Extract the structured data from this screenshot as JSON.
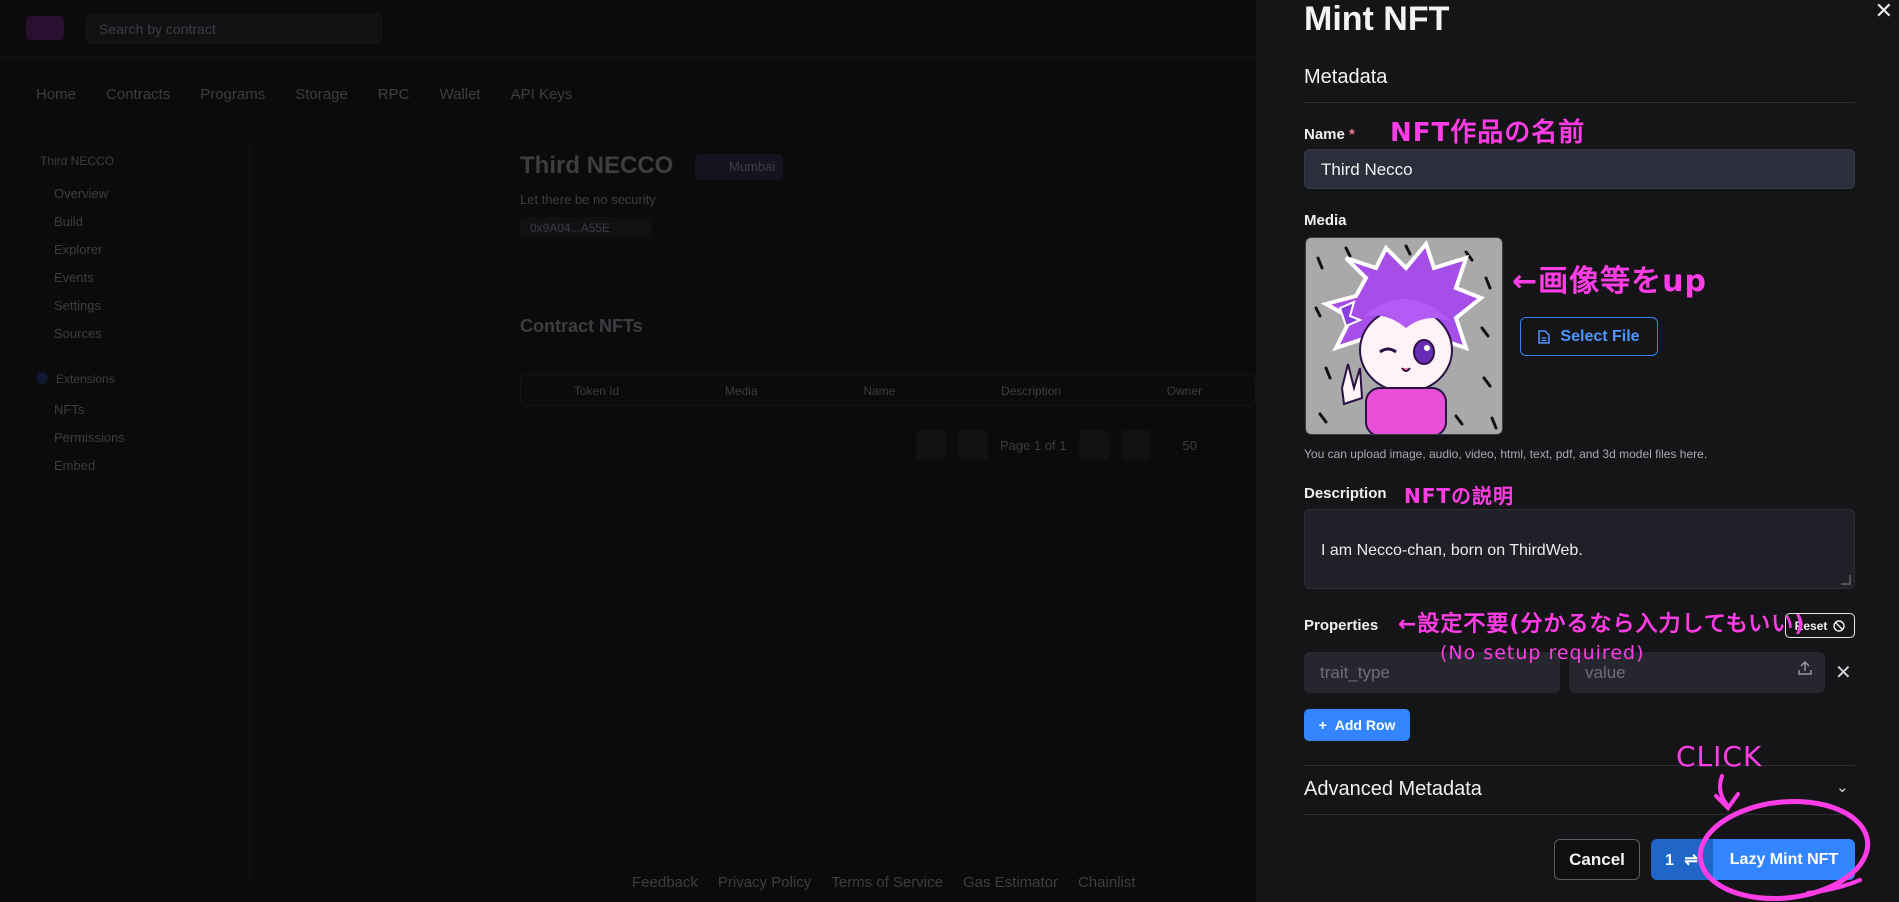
{
  "background": {
    "search_placeholder": "Search by contract",
    "nav": [
      "Home",
      "Contracts",
      "Programs",
      "Storage",
      "RPC",
      "Wallet",
      "API Keys"
    ],
    "sidebar_heading": "Third NECCO",
    "sidebar_items": [
      "Overview",
      "Build",
      "Explorer",
      "Events",
      "Settings",
      "Sources"
    ],
    "sidebar_section": "Extensions",
    "sidebar_items2": [
      "NFTs",
      "Permissions",
      "Embed"
    ],
    "page_title": "Third NECCO",
    "page_badge": "Mumbai",
    "page_subtitle": "Let there be no security",
    "page_address": "0x9A04...A55E",
    "section_heading": "Contract NFTs",
    "table_headers": [
      "Token Id",
      "Media",
      "Name",
      "Description",
      "Owner"
    ],
    "pager_text": "Page 1 of 1",
    "pager_size": "50",
    "footer_links": [
      "Feedback",
      "Privacy Policy",
      "Terms of Service",
      "Gas Estimator",
      "Chainlist"
    ]
  },
  "drawer": {
    "title": "Mint NFT",
    "section": "Metadata",
    "name_label": "Name",
    "required_mark": "*",
    "name_value": "Third Necco",
    "media_label": "Media",
    "select_file_label": "Select File",
    "media_hint": "You can upload image, audio, video, html, text, pdf, and 3d model files here.",
    "description_label": "Description",
    "description_value": "I am Necco-chan, born on ThirdWeb.",
    "properties_label": "Properties",
    "reset_label": "Reset",
    "trait_placeholder": "trait_type",
    "value_placeholder": "value",
    "add_row_label": "Add Row",
    "advanced_label": "Advanced Metadata",
    "cancel_label": "Cancel",
    "quantity": "1",
    "lazy_mint_label": "Lazy Mint NFT"
  },
  "annotations": {
    "name_note": "NFT作品の名前",
    "media_note": "←画像等をup",
    "desc_note": "NFTの説明",
    "props_note": "←設定不要(分かるなら入力してもいい)",
    "props_note_en": "(No setup required)",
    "click_note": "CLICK"
  },
  "colors": {
    "accent": "#3385ff",
    "annotation": "#ff3de6",
    "drawer_bg": "#151517"
  }
}
